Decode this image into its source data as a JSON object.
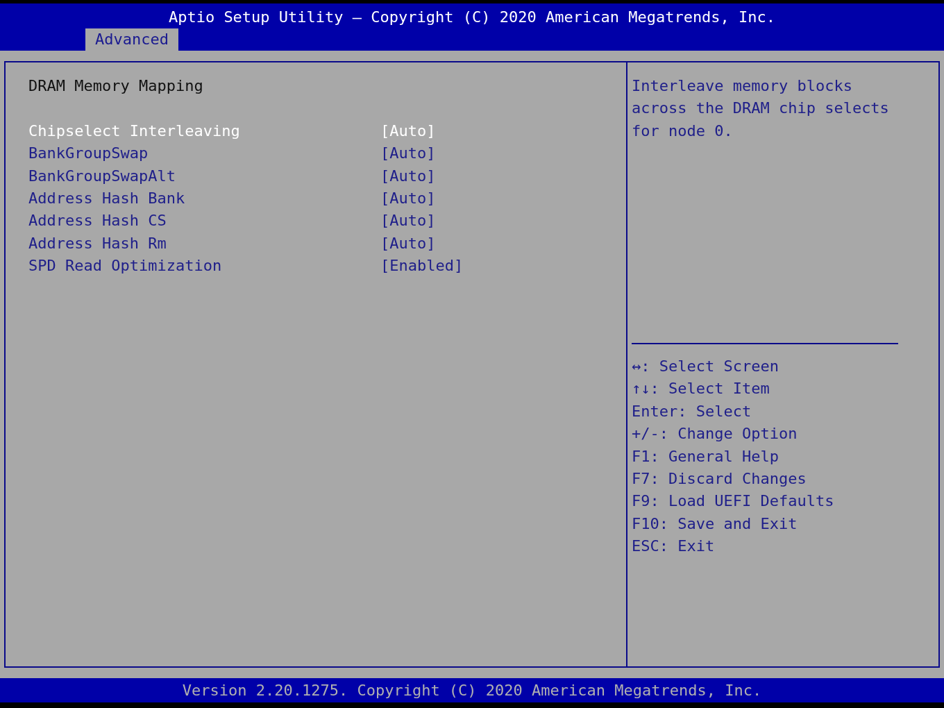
{
  "header": {
    "title": "Aptio Setup Utility – Copyright (C) 2020 American Megatrends, Inc."
  },
  "tabs": [
    {
      "label": "Advanced",
      "selected": true
    }
  ],
  "section_title": "DRAM Memory Mapping",
  "items": [
    {
      "label": "Chipselect Interleaving",
      "value": "[Auto]",
      "selected": true
    },
    {
      "label": "BankGroupSwap",
      "value": "[Auto]",
      "selected": false
    },
    {
      "label": "BankGroupSwapAlt",
      "value": "[Auto]",
      "selected": false
    },
    {
      "label": "Address Hash Bank",
      "value": "[Auto]",
      "selected": false
    },
    {
      "label": "Address Hash CS",
      "value": "[Auto]",
      "selected": false
    },
    {
      "label": "Address Hash Rm",
      "value": "[Auto]",
      "selected": false
    },
    {
      "label": "SPD Read Optimization",
      "value": "[Enabled]",
      "selected": false
    }
  ],
  "help_text": "Interleave memory blocks across the DRAM chip selects for node 0.",
  "key_help": [
    "↔: Select Screen",
    "↑↓: Select Item",
    "Enter: Select",
    "+/-: Change Option",
    "F1: General Help",
    "F7: Discard Changes",
    "F9: Load UEFI Defaults",
    "F10: Save and Exit",
    "ESC: Exit"
  ],
  "footer": "Version 2.20.1275. Copyright (C) 2020 American Megatrends, Inc."
}
